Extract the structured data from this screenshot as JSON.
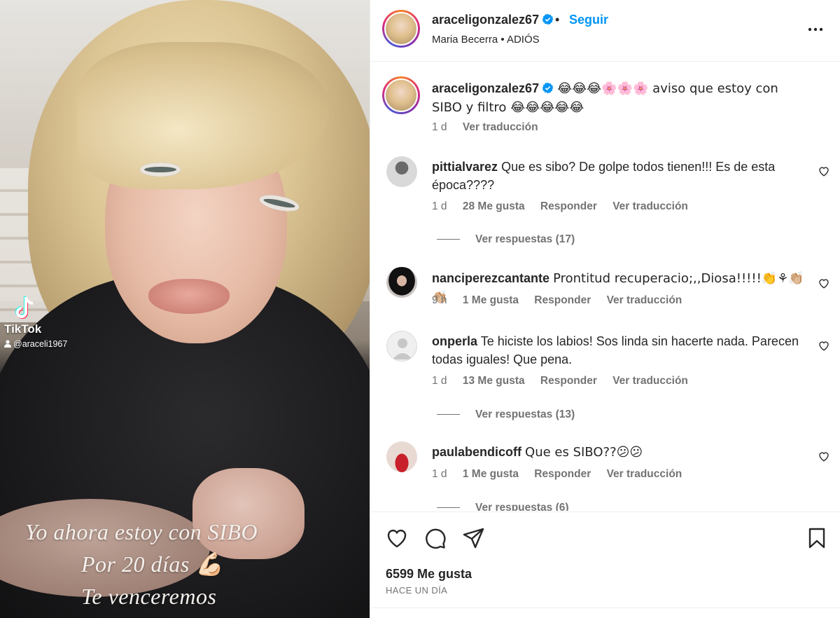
{
  "media": {
    "watermark_brand": "TikTok",
    "watermark_handle": "@araceli1967",
    "overlay_lines": [
      "Yo ahora estoy con SIBO",
      "Por 20 días 💪🏻",
      "Te venceremos"
    ]
  },
  "header": {
    "username": "araceligonzalez67",
    "separator": "•",
    "follow_label": "Seguir",
    "music": "Maria Becerra • ADIÓS"
  },
  "caption": {
    "username": "araceligonzalez67",
    "text": "😂😂😂🌸🌸🌸 aviso que estoy con SIBO y filtro 😂😂😂😂😂",
    "time": "1 d",
    "translate": "Ver traducción"
  },
  "comments": [
    {
      "username": "pittialvarez",
      "text": "Que es sibo? De golpe todos tienen!!! Es de esta época????",
      "time": "1 d",
      "likes": "28 Me gusta",
      "reply": "Responder",
      "translate": "Ver traducción",
      "replies": "Ver respuestas (17)"
    },
    {
      "username": "nanciperezcantante",
      "text": "Prontitud recuperacio;,,Diosa!!!!!👏⚘👏🏼👏🏼",
      "time": "9 h",
      "likes": "1 Me gusta",
      "reply": "Responder",
      "translate": "Ver traducción"
    },
    {
      "username": "onperla",
      "text": "Te hiciste los labios! Sos linda sin hacerte nada. Parecen todas iguales! Que pena.",
      "time": "1 d",
      "likes": "13 Me gusta",
      "reply": "Responder",
      "translate": "Ver traducción",
      "replies": "Ver respuestas (13)"
    },
    {
      "username": "paulabendicoff",
      "text": "Que es SIBO??😕😕",
      "time": "1 d",
      "likes": "1 Me gusta",
      "reply": "Responder",
      "translate": "Ver traducción",
      "replies": "Ver respuestas (6)"
    }
  ],
  "footer": {
    "likes": "6599 Me gusta",
    "date": "HACE UN DÍA"
  },
  "colors": {
    "accent": "#0095f6",
    "text": "#262626",
    "secondary": "#737373",
    "border": "#efefef"
  },
  "icons": [
    "tiktok-logo-icon",
    "verified-badge-icon",
    "more-options-icon",
    "heart-icon",
    "comment-icon",
    "share-icon",
    "bookmark-icon"
  ]
}
